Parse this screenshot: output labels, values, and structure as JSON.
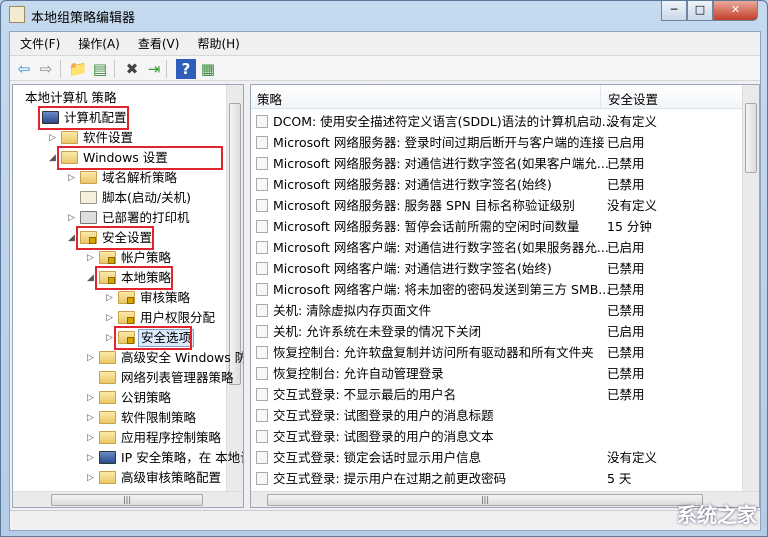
{
  "window": {
    "title": "本地组策略编辑器",
    "min": "─",
    "max": "□",
    "close": "✕"
  },
  "menu": [
    "文件(F)",
    "操作(A)",
    "查看(V)",
    "帮助(H)"
  ],
  "toolbar": [
    {
      "name": "back-icon",
      "glyph": "⇦",
      "color": "#2f8fd8"
    },
    {
      "name": "forward-icon",
      "glyph": "⇨",
      "color": "#888"
    },
    {
      "name": "up-folder-icon",
      "glyph": "📁",
      "color": "#d8a400"
    },
    {
      "name": "show-hide-tree-icon",
      "glyph": "▤",
      "color": "#3a8a3a"
    },
    {
      "name": "delete-icon",
      "glyph": "✖",
      "color": "#444"
    },
    {
      "name": "export-list-icon",
      "glyph": "⇥",
      "color": "#3a9a3a"
    },
    {
      "name": "help-icon",
      "glyph": "?",
      "color": "#fff"
    },
    {
      "name": "properties-icon",
      "glyph": "▦",
      "color": "#3a8a3a"
    }
  ],
  "tree": [
    {
      "label": "本地计算机 策略",
      "level": 0,
      "exp": "",
      "icon": "none"
    },
    {
      "label": "计算机配置",
      "level": 1,
      "exp": "",
      "icon": "computer",
      "red": true
    },
    {
      "label": "软件设置",
      "level": 2,
      "exp": "▷",
      "icon": "folder"
    },
    {
      "label": "Windows 设置",
      "level": 2,
      "exp": "◢",
      "icon": "folder",
      "red": true
    },
    {
      "label": "域名解析策略",
      "level": 3,
      "exp": "▷",
      "icon": "folder"
    },
    {
      "label": "脚本(启动/关机)",
      "level": 3,
      "exp": "",
      "icon": "script"
    },
    {
      "label": "已部署的打印机",
      "level": 3,
      "exp": "▷",
      "icon": "printer"
    },
    {
      "label": "安全设置",
      "level": 3,
      "exp": "◢",
      "icon": "lockfolder",
      "red": true
    },
    {
      "label": "帐户策略",
      "level": 4,
      "exp": "▷",
      "icon": "lockfolder"
    },
    {
      "label": "本地策略",
      "level": 4,
      "exp": "◢",
      "icon": "lockfolder",
      "red": true
    },
    {
      "label": "审核策略",
      "level": 5,
      "exp": "▷",
      "icon": "lockfolder"
    },
    {
      "label": "用户权限分配",
      "level": 5,
      "exp": "▷",
      "icon": "lockfolder"
    },
    {
      "label": "安全选项",
      "level": 5,
      "exp": "▷",
      "icon": "lockfolder",
      "red": true,
      "selected": true
    },
    {
      "label": "高级安全 Windows 防火",
      "level": 4,
      "exp": "▷",
      "icon": "folder"
    },
    {
      "label": "网络列表管理器策略",
      "level": 4,
      "exp": "",
      "icon": "folder"
    },
    {
      "label": "公钥策略",
      "level": 4,
      "exp": "▷",
      "icon": "folder"
    },
    {
      "label": "软件限制策略",
      "level": 4,
      "exp": "▷",
      "icon": "folder"
    },
    {
      "label": "应用程序控制策略",
      "level": 4,
      "exp": "▷",
      "icon": "folder"
    },
    {
      "label": "IP 安全策略，在 本地计算",
      "level": 4,
      "exp": "▷",
      "icon": "computer"
    },
    {
      "label": "高级审核策略配置",
      "level": 4,
      "exp": "▷",
      "icon": "folder"
    }
  ],
  "list": {
    "columns": [
      "策略",
      "安全设置"
    ],
    "rows": [
      [
        "DCOM: 使用安全描述符定义语言(SDDL)语法的计算机启动...",
        "没有定义"
      ],
      [
        "Microsoft 网络服务器: 登录时间过期后断开与客户端的连接",
        "已启用"
      ],
      [
        "Microsoft 网络服务器: 对通信进行数字签名(如果客户端允...",
        "已禁用"
      ],
      [
        "Microsoft 网络服务器: 对通信进行数字签名(始终)",
        "已禁用"
      ],
      [
        "Microsoft 网络服务器: 服务器 SPN 目标名称验证级别",
        "没有定义"
      ],
      [
        "Microsoft 网络服务器: 暂停会话前所需的空闲时间数量",
        "15 分钟"
      ],
      [
        "Microsoft 网络客户端: 对通信进行数字签名(如果服务器允...",
        "已启用"
      ],
      [
        "Microsoft 网络客户端: 对通信进行数字签名(始终)",
        "已禁用"
      ],
      [
        "Microsoft 网络客户端: 将未加密的密码发送到第三方 SMB...",
        "已禁用"
      ],
      [
        "关机: 清除虚拟内存页面文件",
        "已禁用"
      ],
      [
        "关机: 允许系统在未登录的情况下关闭",
        "已启用"
      ],
      [
        "恢复控制台: 允许软盘复制并访问所有驱动器和所有文件夹",
        "已禁用"
      ],
      [
        "恢复控制台: 允许自动管理登录",
        "已禁用"
      ],
      [
        "交互式登录: 不显示最后的用户名",
        "已禁用"
      ],
      [
        "交互式登录: 试图登录的用户的消息标题",
        ""
      ],
      [
        "交互式登录: 试图登录的用户的消息文本",
        ""
      ],
      [
        "交互式登录: 锁定会话时显示用户信息",
        "没有定义"
      ],
      [
        "交互式登录: 提示用户在过期之前更改密码",
        "5 天"
      ]
    ]
  },
  "watermark": "系统之家"
}
